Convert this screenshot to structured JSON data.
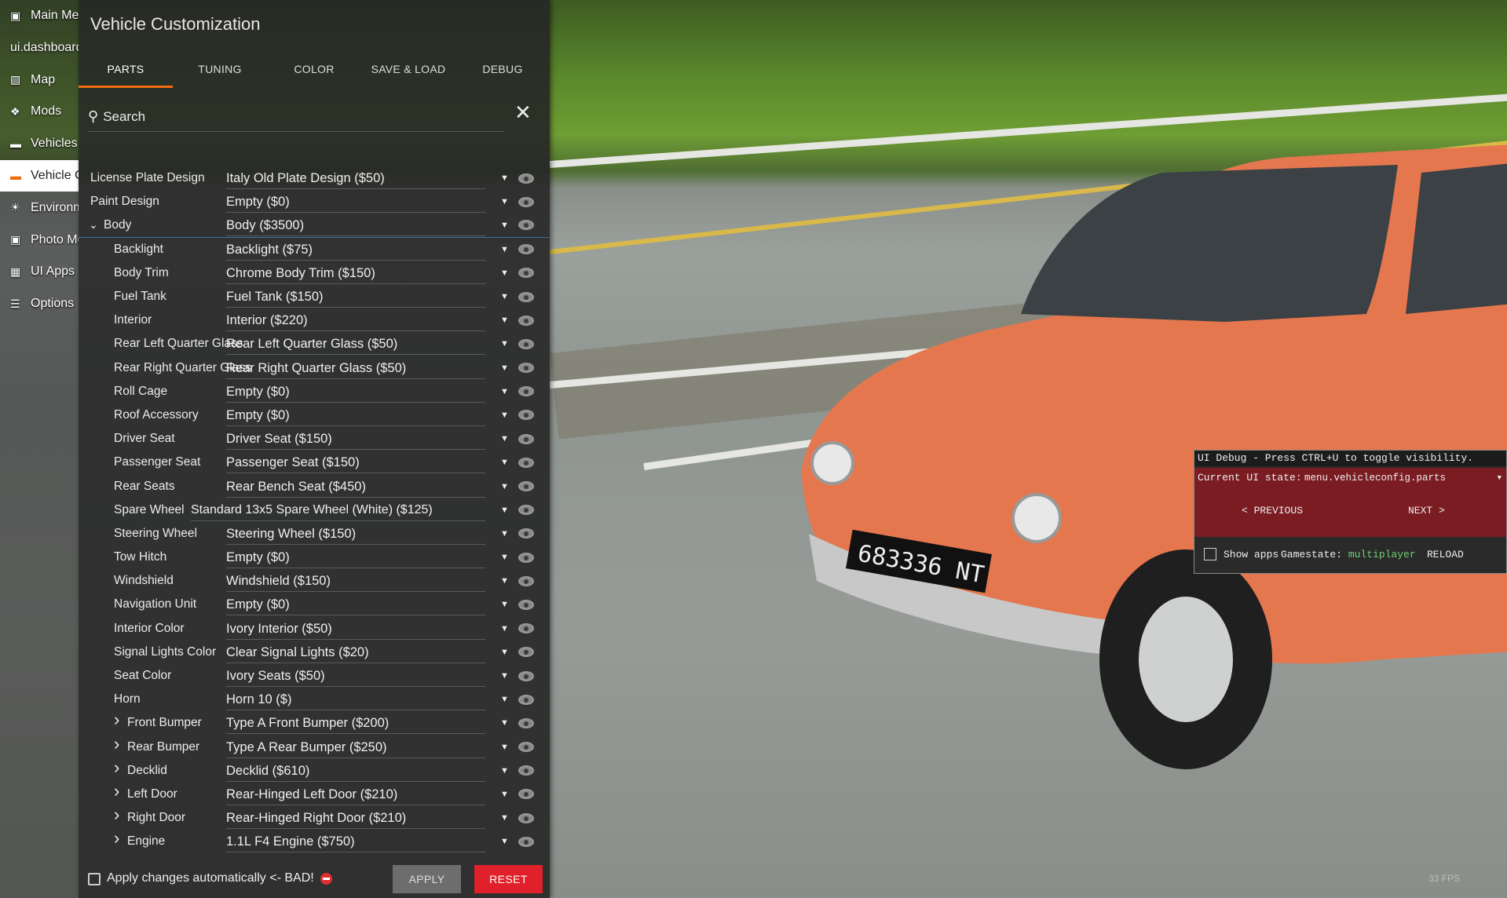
{
  "nav": {
    "items": [
      {
        "icon": "dashboard-icon",
        "label": "Main Menu",
        "active": false
      },
      {
        "icon": "",
        "label": "ui.dashboard",
        "active": false
      },
      {
        "icon": "map-icon",
        "label": "Map",
        "active": false
      },
      {
        "icon": "puzzle-icon",
        "label": "Mods",
        "active": false
      },
      {
        "icon": "car-icon",
        "label": "Vehicles",
        "active": false
      },
      {
        "icon": "car-config-icon",
        "label": "Vehicle Config",
        "active": true
      },
      {
        "icon": "environment-icon",
        "label": "Environment",
        "active": false
      },
      {
        "icon": "camera-icon",
        "label": "Photo Mode",
        "active": false
      },
      {
        "icon": "apps-icon",
        "label": "UI Apps",
        "active": false
      },
      {
        "icon": "sliders-icon",
        "label": "Options",
        "active": false
      }
    ]
  },
  "panel": {
    "title": "Vehicle Customization",
    "tabs": [
      {
        "label": "PARTS",
        "active": true
      },
      {
        "label": "TUNING",
        "active": false
      },
      {
        "label": "COLOR",
        "active": false
      },
      {
        "label": "SAVE & LOAD",
        "active": false
      },
      {
        "label": "DEBUG",
        "active": false
      }
    ],
    "search_placeholder": "Search",
    "parts": [
      {
        "label": "License Plate Design",
        "value": "Italy Old Plate Design ($50)",
        "level": 0,
        "expander": ""
      },
      {
        "label": "Paint Design",
        "value": "Empty ($0)",
        "level": 0,
        "expander": ""
      },
      {
        "label": "Body",
        "value": "Body ($3500)",
        "level": 0,
        "expander": "open"
      },
      {
        "label": "Backlight",
        "value": "Backlight ($75)",
        "level": 1,
        "expander": ""
      },
      {
        "label": "Body Trim",
        "value": "Chrome Body Trim ($150)",
        "level": 1,
        "expander": ""
      },
      {
        "label": "Fuel Tank",
        "value": "Fuel Tank ($150)",
        "level": 1,
        "expander": ""
      },
      {
        "label": "Interior",
        "value": "Interior ($220)",
        "level": 1,
        "expander": ""
      },
      {
        "label": "Rear Left Quarter Glass",
        "value": "Rear Left Quarter Glass ($50)",
        "level": 1,
        "expander": ""
      },
      {
        "label": "Rear Right Quarter Glass",
        "value": "Rear Right Quarter Glass ($50)",
        "level": 1,
        "expander": ""
      },
      {
        "label": "Roll Cage",
        "value": "Empty ($0)",
        "level": 1,
        "expander": ""
      },
      {
        "label": "Roof Accessory",
        "value": "Empty ($0)",
        "level": 1,
        "expander": ""
      },
      {
        "label": "Driver Seat",
        "value": "Driver Seat ($150)",
        "level": 1,
        "expander": ""
      },
      {
        "label": "Passenger Seat",
        "value": "Passenger Seat ($150)",
        "level": 1,
        "expander": ""
      },
      {
        "label": "Rear Seats",
        "value": "Rear Bench Seat ($450)",
        "level": 1,
        "expander": ""
      },
      {
        "label": "Spare Wheel",
        "value": "Standard 13x5 Spare Wheel (White) ($125)",
        "level": 1,
        "expander": ""
      },
      {
        "label": "Steering Wheel",
        "value": "Steering Wheel ($150)",
        "level": 1,
        "expander": ""
      },
      {
        "label": "Tow Hitch",
        "value": "Empty ($0)",
        "level": 1,
        "expander": ""
      },
      {
        "label": "Windshield",
        "value": "Windshield ($150)",
        "level": 1,
        "expander": ""
      },
      {
        "label": "Navigation Unit",
        "value": "Empty ($0)",
        "level": 1,
        "expander": ""
      },
      {
        "label": "Interior Color",
        "value": "Ivory Interior ($50)",
        "level": 1,
        "expander": ""
      },
      {
        "label": "Signal Lights Color",
        "value": "Clear Signal Lights ($20)",
        "level": 1,
        "expander": ""
      },
      {
        "label": "Seat Color",
        "value": "Ivory Seats ($50)",
        "level": 1,
        "expander": ""
      },
      {
        "label": "Horn",
        "value": "Horn 10 ($)",
        "level": 1,
        "expander": ""
      },
      {
        "label": "Front Bumper",
        "value": "Type A Front Bumper ($200)",
        "level": 1,
        "expander": "closed"
      },
      {
        "label": "Rear Bumper",
        "value": "Type A Rear Bumper ($250)",
        "level": 1,
        "expander": "closed"
      },
      {
        "label": "Decklid",
        "value": "Decklid ($610)",
        "level": 1,
        "expander": "closed"
      },
      {
        "label": "Left Door",
        "value": "Rear-Hinged Left Door ($210)",
        "level": 1,
        "expander": "closed"
      },
      {
        "label": "Right Door",
        "value": "Rear-Hinged Right Door ($210)",
        "level": 1,
        "expander": "closed"
      },
      {
        "label": "Engine",
        "value": "1.1L F4 Engine ($750)",
        "level": 1,
        "expander": "closed"
      }
    ],
    "auto_apply_label": "Apply changes automatically <- BAD!",
    "apply_label": "APPLY",
    "reset_label": "RESET"
  },
  "debug": {
    "header": "UI Debug - Press CTRL+U to toggle visibility.",
    "state_label": "Current UI state:",
    "state_value": "menu.vehicleconfig.parts",
    "prev_label": "< PREVIOUS",
    "next_label": "NEXT >",
    "show_apps_label": "Show apps",
    "gamestate_label": "Gamestate:",
    "gamestate_value": "multiplayer",
    "reload_label": "RELOAD"
  },
  "scene": {
    "license_plate": "683336 NT",
    "fps": "33 FPS"
  },
  "colors": {
    "accent": "#f06b10",
    "reset": "#e0202a",
    "debug_state_bg": "#7a1c22",
    "car_paint": "#e5774f"
  }
}
